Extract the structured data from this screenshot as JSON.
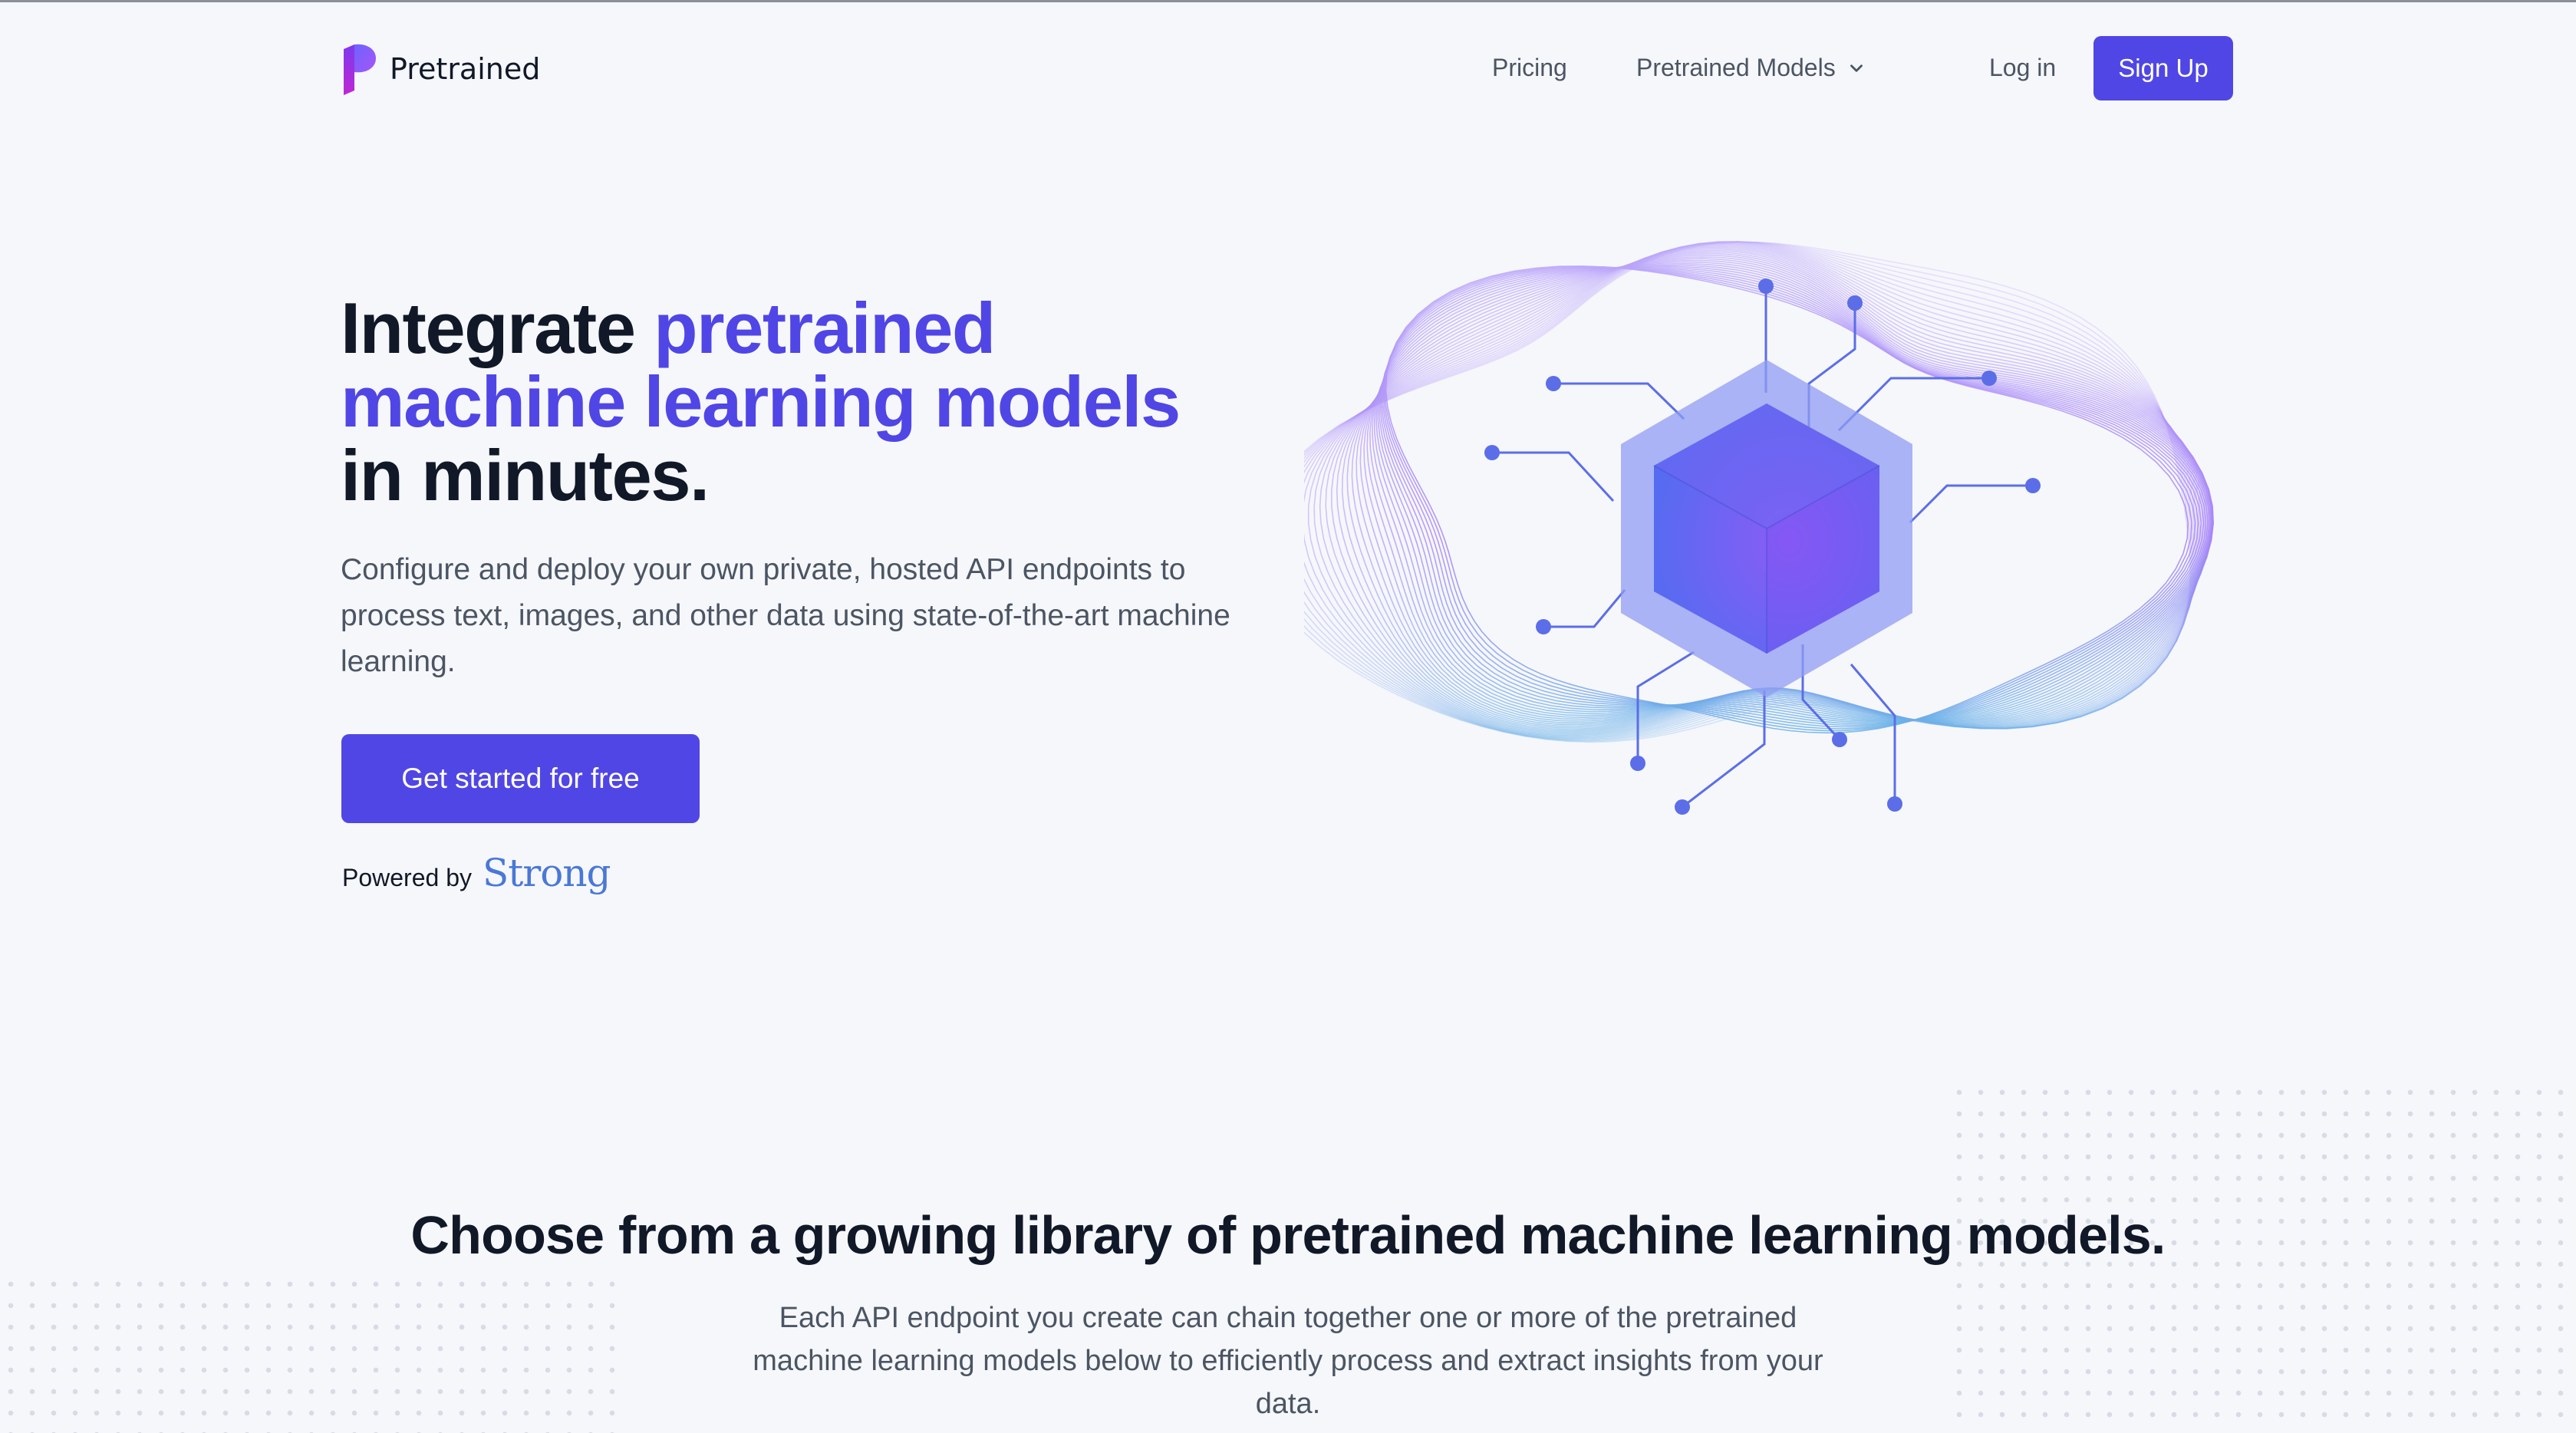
{
  "nav": {
    "brand": "Pretrained",
    "links": [
      "Pricing",
      "Pretrained Models",
      "Log in"
    ],
    "signup_label": "Sign Up"
  },
  "hero": {
    "title_part1": "Integrate ",
    "title_accent": "pretrained machine learning models",
    "title_part2": "in minutes.",
    "subtitle": "Configure and deploy your own private, hosted API endpoints to process text, images, and other data using state-of-the-art machine learning.",
    "cta_label": "Get started for free",
    "powered_label": "Powered by",
    "powered_brand": "Strong"
  },
  "library": {
    "title": "Choose from a growing library of pretrained machine learning models.",
    "subtitle": "Each API endpoint you create can chain together one or more of the pretrained machine learning models below to efficiently process and extract insights from your data."
  },
  "colors": {
    "accent": "#5046e5",
    "background": "#f6f7fb",
    "text": "#111827",
    "muted": "#4b5563",
    "brand_blue": "#4a78d6"
  },
  "icons": [
    "pretrained-logo-icon",
    "chevron-down-icon",
    "ml-cube-illustration"
  ]
}
